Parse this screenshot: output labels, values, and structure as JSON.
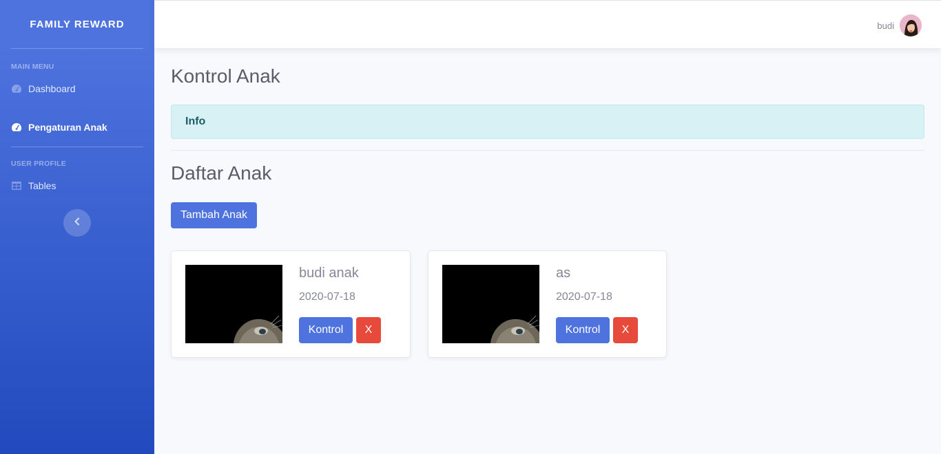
{
  "sidebar": {
    "brand": "FAMILY REWARD",
    "main_menu_heading": "MAIN MENU",
    "items": [
      {
        "label": "Dashboard",
        "icon": "tachometer-icon"
      },
      {
        "label": "Pengaturan Anak",
        "icon": "tachometer-icon"
      }
    ],
    "user_profile_heading": "USER PROFILE",
    "profile_items": [
      {
        "label": "Tables",
        "icon": "table-icon"
      }
    ],
    "toggle_icon": "chevron-left-icon"
  },
  "topbar": {
    "user_name": "budi"
  },
  "main": {
    "page_title": "Kontrol Anak",
    "alert_text": "Info",
    "section_title": "Daftar Anak",
    "add_button": "Tambah Anak",
    "children": [
      {
        "name": "budi anak",
        "date": "2020-07-18",
        "control_label": "Kontrol",
        "delete_label": "X"
      },
      {
        "name": "as",
        "date": "2020-07-18",
        "control_label": "Kontrol",
        "delete_label": "X"
      }
    ]
  },
  "colors": {
    "primary": "#4e73df",
    "danger": "#e74a3b",
    "info_bg": "#d7f1f5"
  }
}
